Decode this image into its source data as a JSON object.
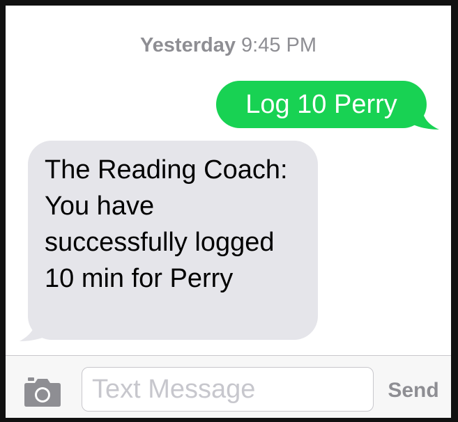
{
  "conversation": {
    "timestamp": {
      "day": "Yesterday",
      "time": "9:45 PM"
    },
    "messages": [
      {
        "direction": "sent",
        "text": "Log 10 Perry",
        "color": "#18d253"
      },
      {
        "direction": "received",
        "text": "The Reading Coach: You have successfully logged 10 min for Perry",
        "color": "#e5e5ea"
      }
    ]
  },
  "input_bar": {
    "camera_icon": "camera-icon",
    "placeholder": "Text Message",
    "value": "",
    "send_label": "Send"
  }
}
